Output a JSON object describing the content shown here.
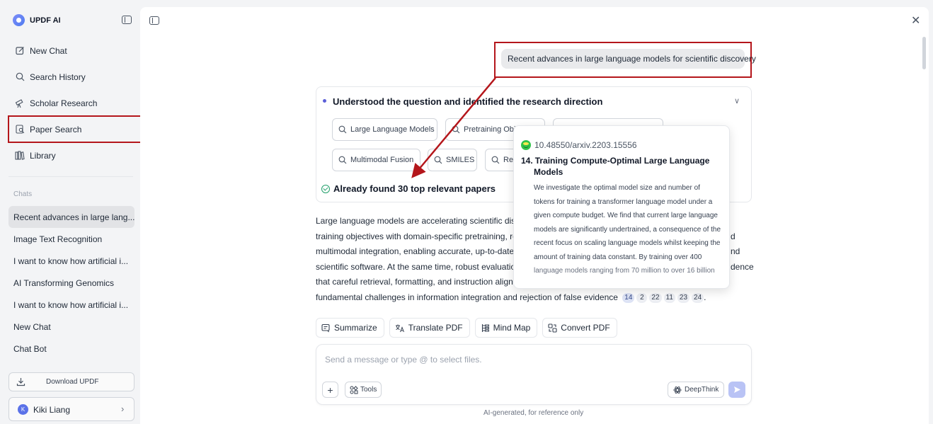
{
  "sidebar": {
    "brand": "UPDF AI",
    "nav": [
      {
        "label": "New Chat",
        "icon": "edit-icon"
      },
      {
        "label": "Search History",
        "icon": "search-icon"
      },
      {
        "label": "Scholar Research",
        "icon": "telescope-icon"
      },
      {
        "label": "Paper Search",
        "icon": "paper-search-icon"
      },
      {
        "label": "Library",
        "icon": "library-icon"
      }
    ],
    "chats_label": "Chats",
    "chats": [
      "Recent advances in large lang...",
      "Image Text Recognition",
      "I want to know how artificial i...",
      "AI Transforming Genomics",
      "I want to know how artificial i...",
      "New Chat",
      "Chat Bot"
    ],
    "download_label": "Download UPDF",
    "user": {
      "initial": "K",
      "name": "Kiki Liang"
    }
  },
  "main": {
    "query": "Recent advances in large language models for scientific discovery",
    "research": {
      "title": "Understood the question and identified the research direction",
      "keywords": [
        "Large Language Models",
        "Pretraining Obj",
        "",
        "Multimodal Fusion",
        "SMILES",
        "Re"
      ],
      "found": "Already found 30 top relevant papers"
    },
    "answer_lines": [
      "Large language models are accelerating scientific disc",
      "training objectives with domain-specific pretraining, re",
      "multimodal integration, enabling accurate, up-to-date",
      "scientific software. At the same time, robust evaluation",
      "that careful retrieval, formatting, and instruction align",
      "fundamental challenges in information integration and rejection of false evidence"
    ],
    "answer_tails": [
      "",
      "d",
      "nd",
      "dence",
      "",
      ""
    ],
    "citations": [
      "14",
      "2",
      "22",
      "11",
      "23",
      "24"
    ],
    "actions": [
      "Summarize",
      "Translate PDF",
      "Mind Map",
      "Convert PDF"
    ],
    "composer": {
      "placeholder": "Send a message or type @ to select files.",
      "tools_label": "Tools",
      "deepthink_label": "DeepThink"
    },
    "footnote": "AI-generated, for reference only"
  },
  "tooltip": {
    "doi": "10.48550/arxiv.2203.15556",
    "number": "14.",
    "title_line1": "Training Compute-Optimal Large Language",
    "title_line2": "Models",
    "abstract": [
      "We investigate the optimal model size and number of",
      "tokens for training a transformer language model under a",
      "given compute budget. We find that current large language",
      "models are significantly undertrained, a consequence of the",
      "recent focus on scaling language models whilst keeping the",
      "amount of training data constant. By training over 400",
      "language models ranging from 70 million to over 16 billion"
    ]
  },
  "colors": {
    "highlight": "#b4161b",
    "accent": "#5b5fd8",
    "send": "#b9c3f5"
  }
}
